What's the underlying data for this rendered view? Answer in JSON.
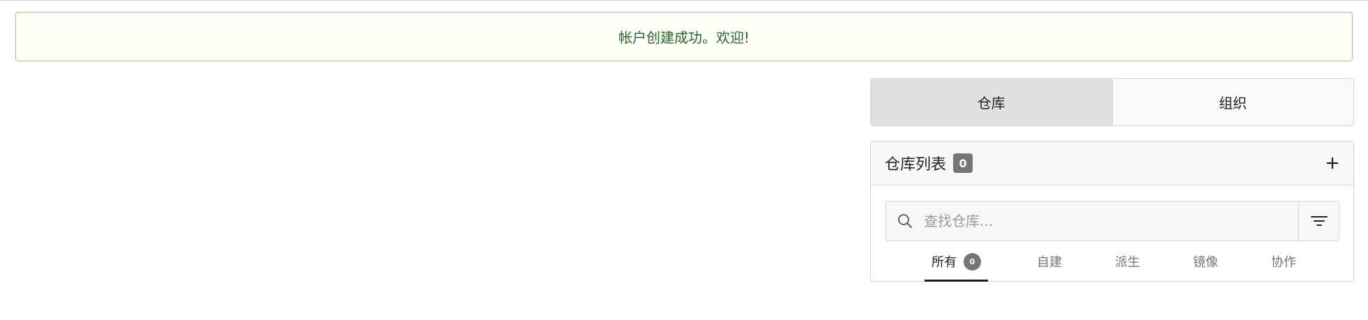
{
  "flash": {
    "message": "帐户创建成功。欢迎!"
  },
  "dashboard_tabs": [
    {
      "label": "仓库",
      "active": true
    },
    {
      "label": "组织",
      "active": false
    }
  ],
  "repo_panel": {
    "title": "仓库列表",
    "count": "0",
    "add_icon": "plus-icon",
    "search": {
      "placeholder": "查找仓库...",
      "value": "",
      "icon": "search-icon"
    },
    "filter_icon": "filter-icon",
    "filter_tabs": [
      {
        "label": "所有",
        "count": "0",
        "active": true
      },
      {
        "label": "自建",
        "active": false
      },
      {
        "label": "派生",
        "active": false
      },
      {
        "label": "镜像",
        "active": false
      },
      {
        "label": "协作",
        "active": false
      }
    ]
  },
  "colors": {
    "success_border": "#a3c293",
    "success_bg": "#fcfff5",
    "success_text": "#2c662d",
    "badge_bg": "#767676",
    "active_tab_bg": "#e0e0e0"
  }
}
